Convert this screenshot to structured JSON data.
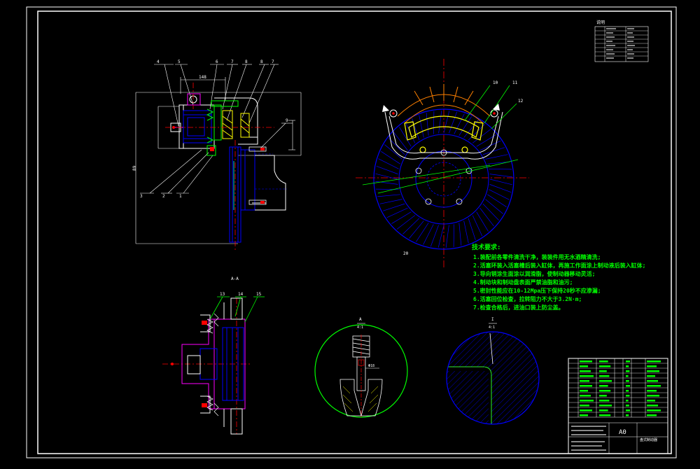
{
  "colors": {
    "background": "#000000",
    "frame": "#ffffff",
    "green": "#00ff00",
    "yellow": "#ffff00",
    "blue": "#0000ff",
    "red": "#ff0000",
    "magenta": "#ff00ff",
    "cyan": "#00ffff",
    "orange": "#ff8000"
  },
  "caliper_view": {
    "callouts": [
      "4",
      "5",
      "6",
      "7",
      "8",
      "8",
      "7",
      "9",
      "3",
      "2",
      "1"
    ],
    "dim_top": "148",
    "dim_left": "89",
    "section_label": "A-A"
  },
  "front_view": {
    "callouts": [
      "10",
      "11",
      "12"
    ],
    "scale_note": "20"
  },
  "lower_section": {
    "callouts": [
      "13",
      "14",
      "15"
    ]
  },
  "detail_a": {
    "label": "A",
    "scale": "4:1",
    "dim": "Φ18"
  },
  "detail_b": {
    "label": "I",
    "scale": "4:1"
  },
  "notes": {
    "heading": "技术要求:",
    "items": [
      "1.装配前各零件清洗干净，装装件用无水酒精清洗;",
      "2.活塞环装入活塞槽后装入缸体，再施工作面涂上制动液后装入缸体;",
      "3.导向销涂生面涂以润滑脂，使制动器移动灵活;",
      "4.制动块和制动盘表面严禁油脂和油污;",
      "5.密封性能应在10-12Mpa压下保持20秒不应渗漏;",
      "6.活塞回位检查，拉转阻力不大于3.2N·m;",
      "7.检查合格后，进油口装上防尘盖。"
    ]
  },
  "top_table": {
    "title": "说明"
  },
  "title_block": {
    "sheet_size": "A0",
    "drawing_name": "盘式制动器"
  }
}
